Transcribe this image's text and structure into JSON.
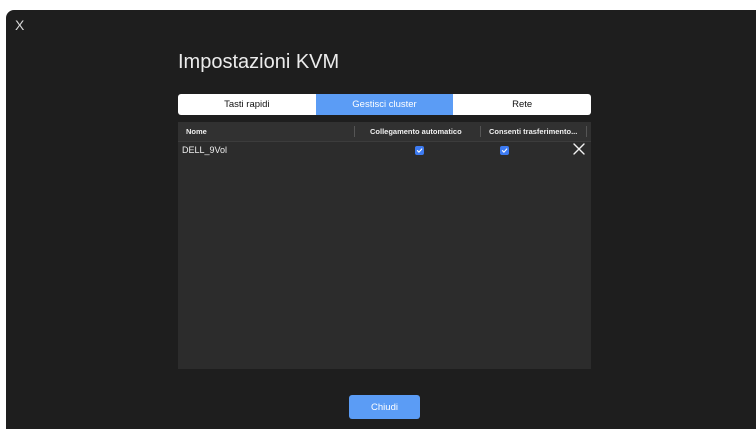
{
  "window": {
    "close_label": "X"
  },
  "header": {
    "title": "Impostazioni KVM"
  },
  "tabs": [
    {
      "label": "Tasti rapidi",
      "active": false
    },
    {
      "label": "Gestisci cluster",
      "active": true
    },
    {
      "label": "Rete",
      "active": false
    }
  ],
  "table": {
    "columns": [
      "Nome",
      "Collegamento automatico",
      "Consenti trasferimento..."
    ],
    "rows": [
      {
        "name": "DELL_9Vol",
        "auto_connect": true,
        "allow_transfer": true
      }
    ]
  },
  "footer": {
    "close_button_label": "Chiudi"
  },
  "colors": {
    "accent": "#5b9cf5",
    "checkbox": "#3d7bf2",
    "background": "#1e1e1e",
    "table_background": "#2c2c2c"
  },
  "icons": {
    "window_close": "close-icon",
    "row_remove": "remove-icon",
    "checked": "checkmark-icon"
  }
}
